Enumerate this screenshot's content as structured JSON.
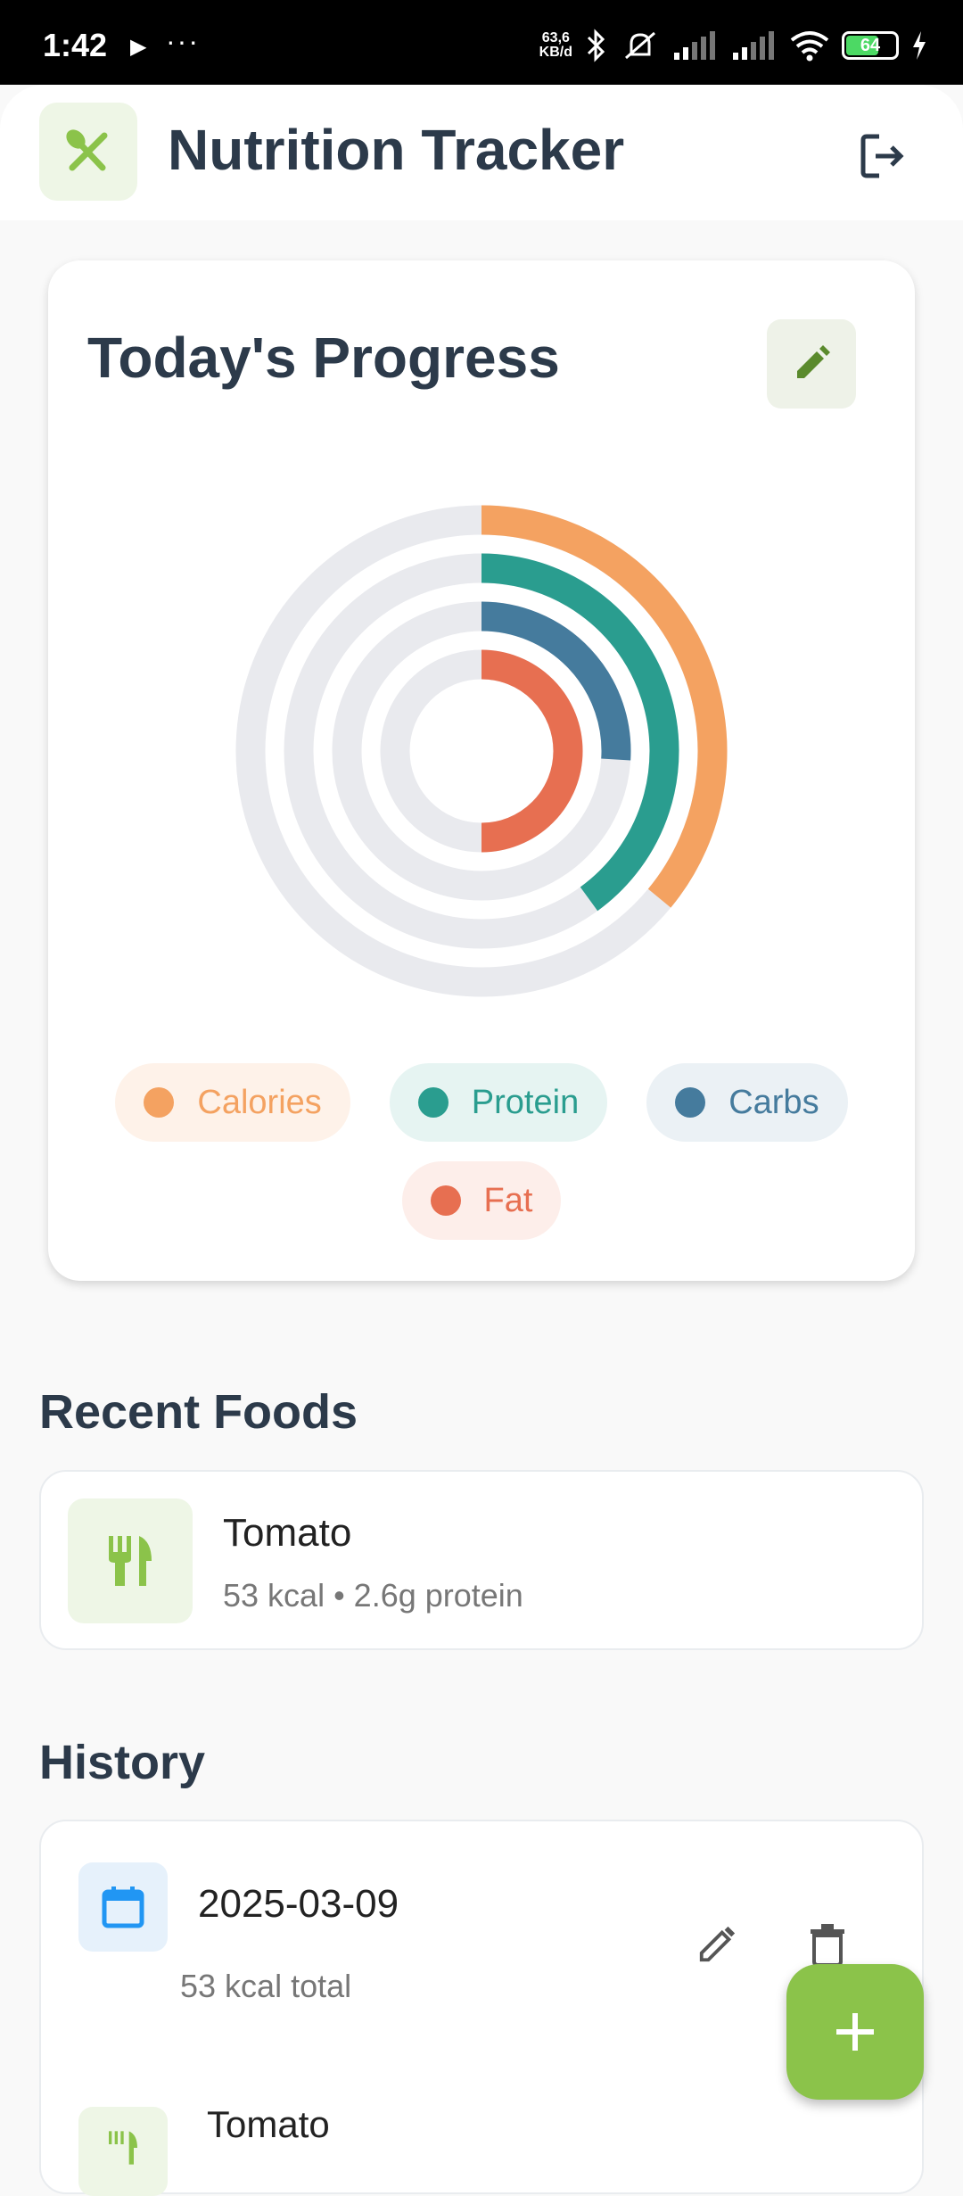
{
  "status_bar": {
    "time": "1:42",
    "more": "···",
    "speed_top": "63,6",
    "speed_bottom": "KB/d",
    "battery": "64"
  },
  "app_bar": {
    "title": "Nutrition Tracker"
  },
  "progress": {
    "title": "Today's Progress",
    "rings": [
      {
        "name": "Calories",
        "fraction": 0.36,
        "color": "#f4a261",
        "track": "#e9eaee"
      },
      {
        "name": "Protein",
        "fraction": 0.4,
        "color": "#2a9d8f",
        "track": "#e9eaee"
      },
      {
        "name": "Carbs",
        "fraction": 0.26,
        "color": "#457b9d",
        "track": "#e9eaee"
      },
      {
        "name": "Fat",
        "fraction": 0.5,
        "color": "#e76f51",
        "track": "#e9eaee"
      }
    ],
    "legend": [
      {
        "label": "Calories",
        "color": "#f4a261",
        "bg": "#fef2e9",
        "text": "#f4a261"
      },
      {
        "label": "Protein",
        "color": "#2a9d8f",
        "bg": "#e6f4f2",
        "text": "#2a9d8f"
      },
      {
        "label": "Carbs",
        "color": "#457b9d",
        "bg": "#ebf1f5",
        "text": "#457b9d"
      },
      {
        "label": "Fat",
        "color": "#e76f51",
        "bg": "#fdeeea",
        "text": "#e76f51"
      }
    ]
  },
  "recent": {
    "title": "Recent Foods",
    "items": [
      {
        "name": "Tomato",
        "meta": "53 kcal • 2.6g protein"
      }
    ]
  },
  "history": {
    "title": "History",
    "entries": [
      {
        "date": "2025-03-09",
        "total": "53 kcal total",
        "items": [
          {
            "name": "Tomato"
          }
        ]
      }
    ]
  },
  "colors": {
    "accent": "#8bc34a",
    "text": "#2c3a4a"
  }
}
